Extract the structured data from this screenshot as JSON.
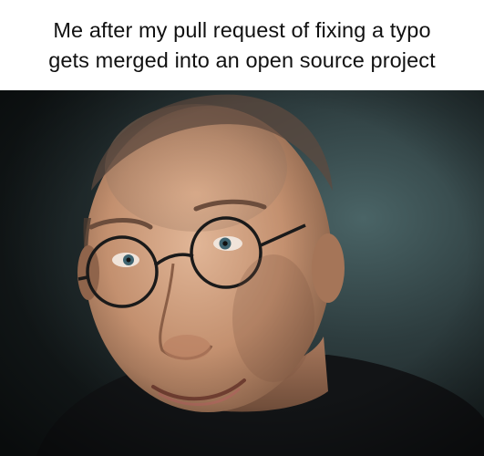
{
  "caption": {
    "line1": "Me after my pull request of fixing a typo",
    "line2": "gets merged into an open source project"
  },
  "photo": {
    "subject": "smiling-man-with-round-glasses",
    "colors": {
      "background_dark": "#1c2224",
      "background_teal": "#3e5659",
      "skin": "#c99878",
      "shirt": "#141618"
    }
  }
}
